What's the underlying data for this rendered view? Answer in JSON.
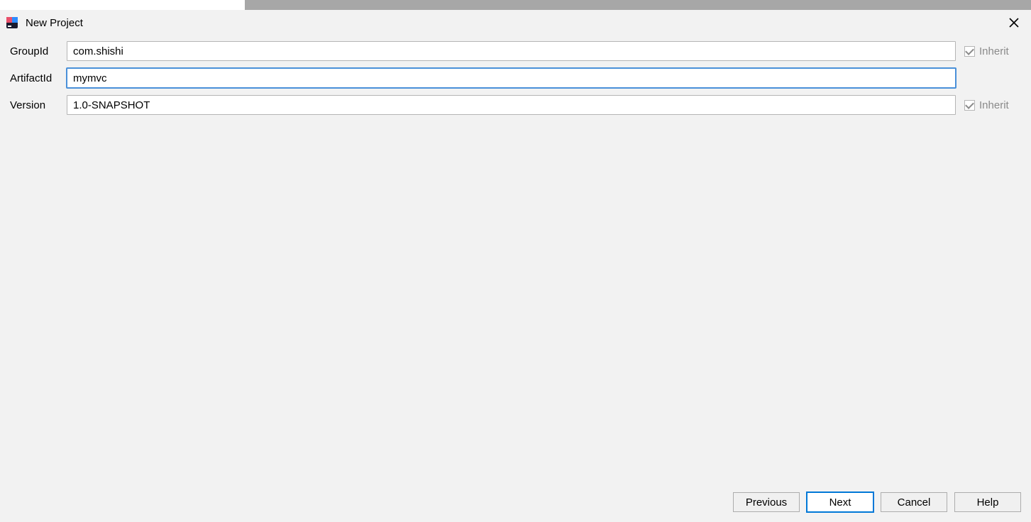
{
  "window": {
    "title": "New Project"
  },
  "form": {
    "groupId": {
      "label": "GroupId",
      "value": "com.shishi",
      "inherit_label": "Inherit",
      "inherit_checked": true
    },
    "artifactId": {
      "label": "ArtifactId",
      "value": "mymvc"
    },
    "version": {
      "label": "Version",
      "value": "1.0-SNAPSHOT",
      "inherit_label": "Inherit",
      "inherit_checked": true
    }
  },
  "buttons": {
    "previous": "Previous",
    "next": "Next",
    "cancel": "Cancel",
    "help": "Help"
  }
}
